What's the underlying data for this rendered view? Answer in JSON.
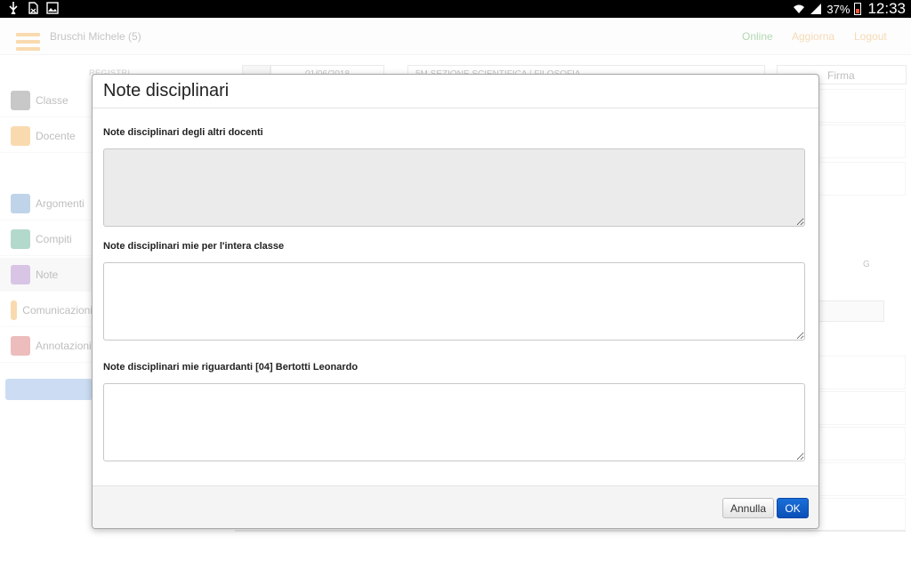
{
  "statusbar": {
    "battery": "37%",
    "time": "12:33"
  },
  "app": {
    "user_name": "Bruschi Michele (5)",
    "links": {
      "online": "Online",
      "aggiorna": "Aggiorna",
      "logout": "Logout"
    },
    "filters": {
      "label": "REGISTRI",
      "date": "01/06/2018",
      "class": "5M SEZIONE SCIENTIFICA / FILOSOFIA",
      "firma": "Firma"
    },
    "sidebar": [
      {
        "label": "Classe",
        "icon": "classe-icon",
        "color": "#707070"
      },
      {
        "label": "Docente",
        "icon": "docente-icon",
        "color": "#f0a030"
      },
      {
        "label": "Argomenti",
        "icon": "argomenti-icon",
        "color": "#5a8fc8"
      },
      {
        "label": "Compiti",
        "icon": "compiti-icon",
        "color": "#3a9a7a"
      },
      {
        "label": "Note",
        "icon": "note-icon",
        "color": "#9a6ac0"
      },
      {
        "label": "Comunicazioni",
        "icon": "comunicazioni-icon",
        "color": "#f0a030"
      },
      {
        "label": "Annotazioni",
        "icon": "annotazioni-icon",
        "color": "#d05050"
      }
    ],
    "right_label": "G"
  },
  "modal": {
    "title": "Note disciplinari",
    "fields": [
      {
        "label": "Note disciplinari degli altri docenti",
        "value": "",
        "readonly": true
      },
      {
        "label": "Note disciplinari mie per l'intera classe",
        "value": "",
        "readonly": false
      },
      {
        "label": "Note disciplinari mie riguardanti [04] Bertotti Leonardo",
        "value": "",
        "readonly": false
      }
    ],
    "buttons": {
      "cancel": "Annulla",
      "ok": "OK"
    }
  },
  "colors": {
    "accent": "#0a50b8",
    "brand": "#f0a030",
    "online": "#3a9a3a"
  }
}
